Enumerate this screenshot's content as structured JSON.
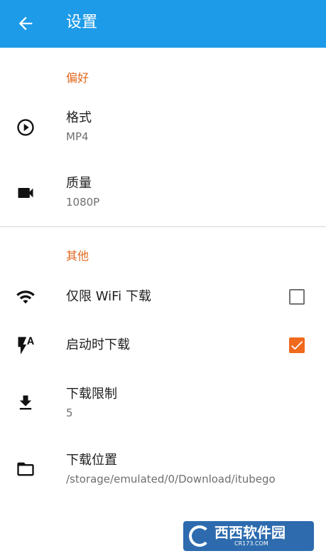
{
  "appbar": {
    "title": "设置",
    "back_icon": "arrow-back-icon"
  },
  "sections": {
    "preferences": {
      "header": "偏好"
    },
    "other": {
      "header": "其他"
    }
  },
  "settings": {
    "format": {
      "label": "格式",
      "value": "MP4",
      "icon": "play-circle-icon"
    },
    "quality": {
      "label": "质量",
      "value": "1080P",
      "icon": "videocam-icon"
    },
    "wifi_only": {
      "label": "仅限 WiFi 下载",
      "checked": false,
      "icon": "wifi-icon"
    },
    "download_on_start": {
      "label": "启动时下载",
      "checked": true,
      "icon": "flash-auto-icon"
    },
    "download_limit": {
      "label": "下载限制",
      "value": "5",
      "icon": "download-icon"
    },
    "download_location": {
      "label": "下载位置",
      "value": "/storage/emulated/0/Download/itubego",
      "icon": "folder-icon"
    }
  },
  "watermark": {
    "text": "西西软件园",
    "subtext": "CR173.COM"
  },
  "colors": {
    "appbar": "#1e9be8",
    "accent": "#e0661c",
    "checkbox_checked": "#f06a1e"
  }
}
